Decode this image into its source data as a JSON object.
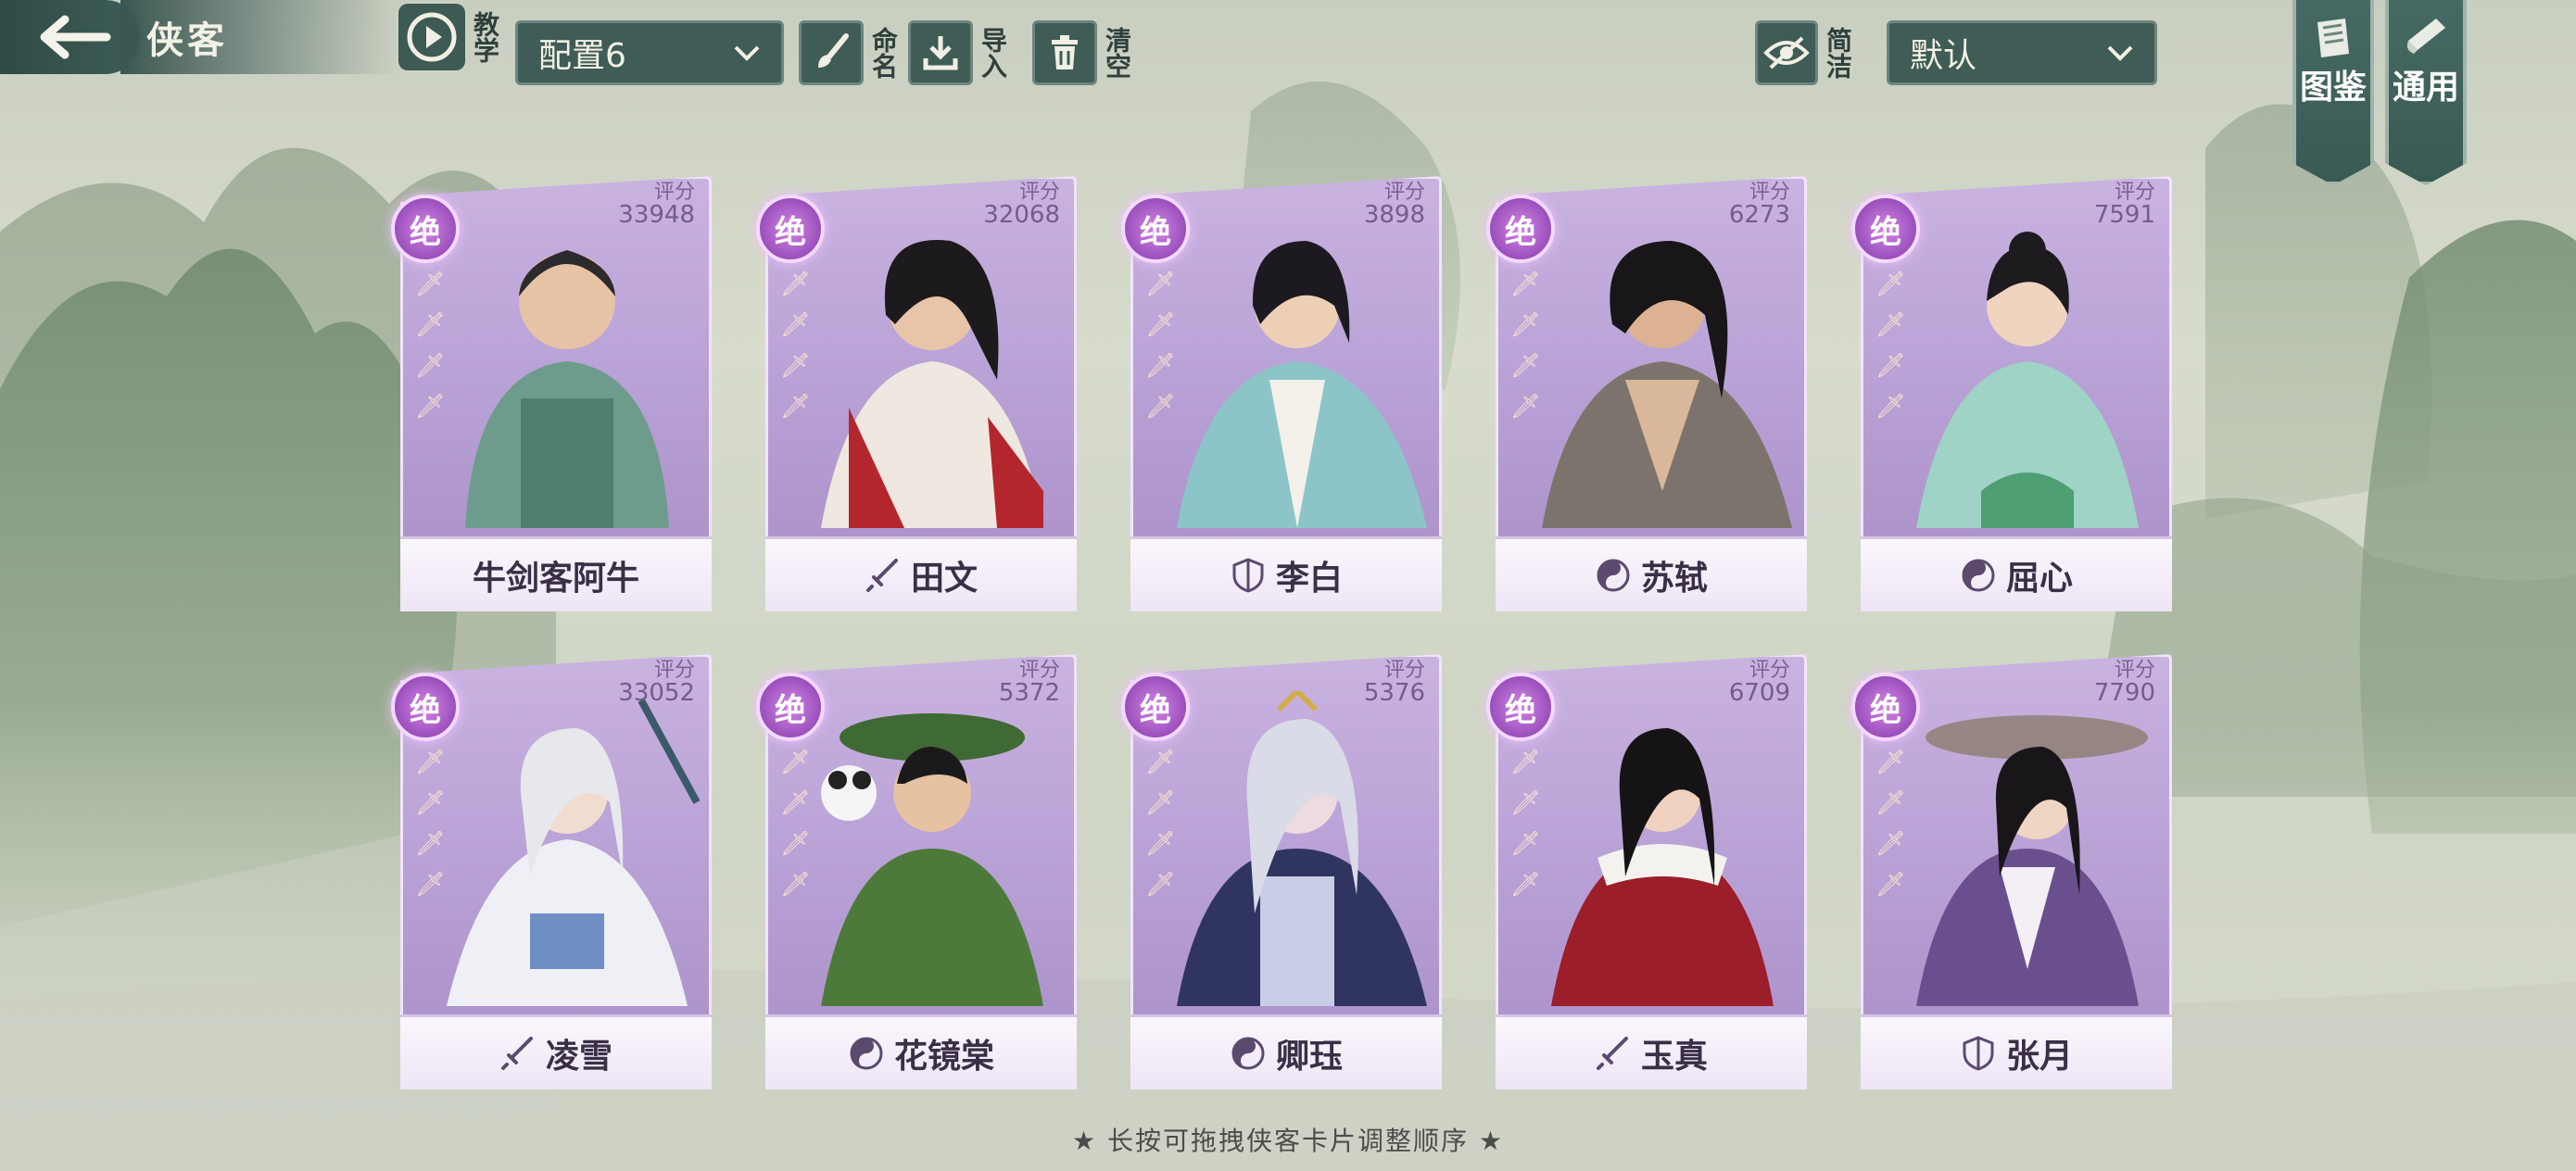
{
  "header": {
    "title": "侠客",
    "tutorial_label": "教学",
    "preset": "配置6",
    "rename_label": "命名",
    "import_label": "导入",
    "clear_label": "清空",
    "simple_label": "简洁",
    "sort": "默认",
    "codex_label": "图鉴",
    "general_label": "通用"
  },
  "cards": [
    {
      "name": "牛剑客阿牛",
      "score_label": "评分",
      "score": "33948",
      "rank": "绝",
      "class_icon": "none"
    },
    {
      "name": "田文",
      "score_label": "评分",
      "score": "32068",
      "rank": "绝",
      "class_icon": "sword-icon"
    },
    {
      "name": "李白",
      "score_label": "评分",
      "score": "3898",
      "rank": "绝",
      "class_icon": "shield-icon"
    },
    {
      "name": "苏轼",
      "score_label": "评分",
      "score": "6273",
      "rank": "绝",
      "class_icon": "taiji-icon"
    },
    {
      "name": "屈心",
      "score_label": "评分",
      "score": "7591",
      "rank": "绝",
      "class_icon": "taiji-icon"
    },
    {
      "name": "凌雪",
      "score_label": "评分",
      "score": "33052",
      "rank": "绝",
      "class_icon": "sword-icon"
    },
    {
      "name": "花镜棠",
      "score_label": "评分",
      "score": "5372",
      "rank": "绝",
      "class_icon": "taiji-icon"
    },
    {
      "name": "卿珏",
      "score_label": "评分",
      "score": "5376",
      "rank": "绝",
      "class_icon": "taiji-icon"
    },
    {
      "name": "玉真",
      "score_label": "评分",
      "score": "6709",
      "rank": "绝",
      "class_icon": "sword-icon"
    },
    {
      "name": "张月",
      "score_label": "评分",
      "score": "7790",
      "rank": "绝",
      "class_icon": "shield-icon"
    }
  ],
  "footer": {
    "hint": "★ 长按可拖拽侠客卡片调整顺序 ★"
  },
  "colors": {
    "panel": "#3f5c56",
    "card": "#b9a2d6",
    "glow": "#f0c0ff"
  }
}
